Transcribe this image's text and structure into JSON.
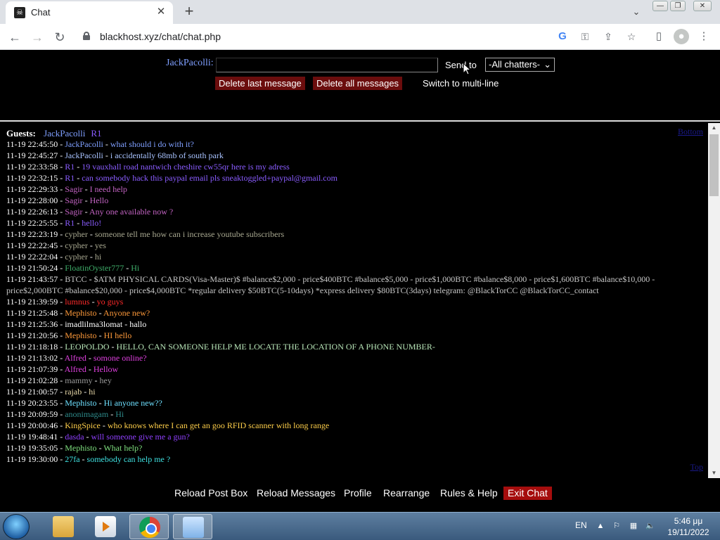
{
  "browser": {
    "tab_title": "Chat",
    "url": "blackhost.xyz/chat/chat.php",
    "new_tab_symbol": "+",
    "tab_close_symbol": "✕"
  },
  "postbox": {
    "nickname": "JackPacolli",
    "colon": ":",
    "message_value": "",
    "send_to_label": "Send to",
    "send_to_selected": "-All chatters-",
    "delete_last_label": "Delete last message",
    "delete_all_label": "Delete all messages",
    "switch_multiline_label": "Switch to multi-line"
  },
  "chat": {
    "guests_label": "Guests:",
    "guests": [
      {
        "name": "JackPacolli",
        "color": "#7f9fff"
      },
      {
        "name": "R1",
        "color": "#8a5cff"
      }
    ],
    "bottom_link": "Bottom",
    "top_link": "Top",
    "messages": [
      {
        "time": "11-19 22:45:50",
        "user": "JackPacolli",
        "text": "what should i do with it?",
        "color": "#7f9fff"
      },
      {
        "time": "11-19 22:45:27",
        "user": "JackPacolli",
        "text": "i accidentally 68mb of south park",
        "color": "#a9c3ff"
      },
      {
        "time": "11-19 22:33:58",
        "user": "R1",
        "text": "19 vauxhall road nantwich cheshire cw55qr here is my adress",
        "color": "#8a5cff"
      },
      {
        "time": "11-19 22:32:15",
        "user": "R1",
        "text": "can somebody hack this paypal email pls sneaktoggled+paypal@gmail.com",
        "color": "#8a5cff"
      },
      {
        "time": "11-19 22:29:33",
        "user": "Sagir",
        "text": "I need help",
        "color": "#c464c4"
      },
      {
        "time": "11-19 22:28:00",
        "user": "Sagir",
        "text": "Hello",
        "color": "#c464c4"
      },
      {
        "time": "11-19 22:26:13",
        "user": "Sagir",
        "text": "Any one available now ?",
        "color": "#c464c4"
      },
      {
        "time": "11-19 22:25:55",
        "user": "R1",
        "text": "hello!",
        "color": "#8a5cff"
      },
      {
        "time": "11-19 22:23:19",
        "user": "cypher",
        "text": "someone tell me how can i increase youtube subscribers",
        "color": "#a8a890"
      },
      {
        "time": "11-19 22:22:45",
        "user": "cypher",
        "text": "yes",
        "color": "#a8a890"
      },
      {
        "time": "11-19 22:22:04",
        "user": "cypher",
        "text": "hi",
        "color": "#a8a890"
      },
      {
        "time": "11-19 21:50:24",
        "user": "FloatinOyster777",
        "text": "Hi",
        "color": "#3fae6a"
      },
      {
        "time": "11-19 21:43:57",
        "user": "BTCC",
        "text": "$ATM PHYSICAL CARDS(Visa-Master)$ #balance$2,000 - price$400BTC #balance$5,000 - price$1,000BTC #balance$8,000 - price$1,600BTC #balance$10,000 - price$2,000BTC #balance$20,000 - price$4,000BTC *regular delivery $50BTC(5-10days) *express delivery $80BTC(3days) telegram: @BlackTorCC @BlackTorCC_contact",
        "color": "#c8c8c8"
      },
      {
        "time": "11-19 21:39:59",
        "user": "lumnus",
        "text": "yo guys",
        "color": "#ff2a2a"
      },
      {
        "time": "11-19 21:25:48",
        "user": "Mephisto",
        "text": "Anyone new?",
        "color": "#ff9a3a"
      },
      {
        "time": "11-19 21:25:36",
        "user": "imadlilma3lomat",
        "text": "hallo",
        "color": "#ffffff"
      },
      {
        "time": "11-19 21:20:56",
        "user": "Mephisto",
        "text": "HI hello",
        "color": "#ff9a3a"
      },
      {
        "time": "11-19 21:18:18",
        "user": "LEOPOLDO",
        "text": "HELLO, CAN SOMEONE HELP ME LOCATE THE LOCATION OF A PHONE NUMBER-",
        "color": "#b8e6b8"
      },
      {
        "time": "11-19 21:13:02",
        "user": "Alfred",
        "text": "somone online?",
        "color": "#e040e0"
      },
      {
        "time": "11-19 21:07:39",
        "user": "Alfred",
        "text": "Hellow",
        "color": "#e040e0"
      },
      {
        "time": "11-19 21:02:28",
        "user": "mammy",
        "text": "hey",
        "color": "#9a9a9a"
      },
      {
        "time": "11-19 21:00:57",
        "user": "rajab",
        "text": "hi",
        "color": "#e8d8a8"
      },
      {
        "time": "11-19 20:23:55",
        "user": "Mephisto",
        "text": "Hi anyone new??",
        "color": "#6ee0ff"
      },
      {
        "time": "11-19 20:09:59",
        "user": "anonimagam",
        "text": "Hi",
        "color": "#2e8a8a"
      },
      {
        "time": "11-19 20:00:46",
        "user": "KingSpice",
        "text": "who knows where I can get an goo RFID scanner with long range",
        "color": "#ffcf4a"
      },
      {
        "time": "11-19 19:48:41",
        "user": "dasda",
        "text": "will someone give me a gun?",
        "color": "#9040ff"
      },
      {
        "time": "11-19 19:35:05",
        "user": "Mephisto",
        "text": "What help?",
        "color": "#7fe07f"
      },
      {
        "time": "11-19 19:30:00",
        "user": "27fa",
        "text": "somebody can help me ?",
        "color": "#3fe0e0"
      }
    ]
  },
  "controls": {
    "reload_post_box": "Reload Post Box",
    "reload_messages": "Reload Messages",
    "profile": "Profile",
    "rearrange": "Rearrange",
    "rules_help": "Rules & Help",
    "exit_chat": "Exit Chat"
  },
  "taskbar": {
    "language": "EN",
    "time": "5:46 μμ",
    "date": "19/11/2022"
  }
}
